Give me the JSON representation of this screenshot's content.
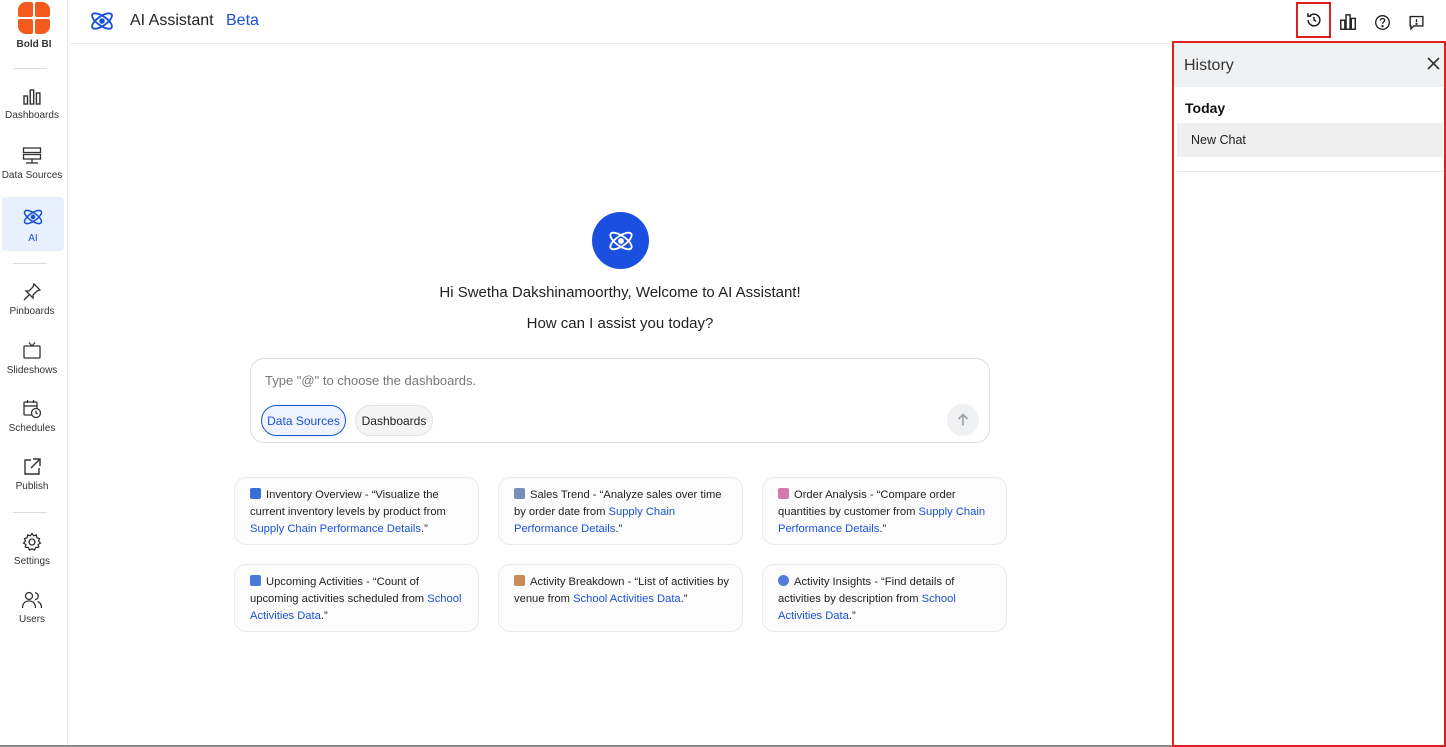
{
  "brand": {
    "name": "Bold BI"
  },
  "nav": {
    "items": [
      {
        "label": "Dashboards",
        "icon": "bar-chart-icon"
      },
      {
        "label": "Data Sources",
        "icon": "server-icon"
      },
      {
        "label": "AI",
        "icon": "atom-icon",
        "active": true
      },
      {
        "label": "Pinboards",
        "icon": "pin-icon"
      },
      {
        "label": "Slideshows",
        "icon": "tv-icon"
      },
      {
        "label": "Schedules",
        "icon": "calendar-clock-icon"
      },
      {
        "label": "Publish",
        "icon": "publish-icon"
      },
      {
        "label": "Settings",
        "icon": "gear-icon"
      },
      {
        "label": "Users",
        "icon": "users-icon"
      }
    ]
  },
  "header": {
    "title": "AI Assistant",
    "badge": "Beta",
    "actions": [
      "history-icon",
      "chart-icon",
      "help-icon",
      "feedback-icon"
    ]
  },
  "main": {
    "greeting": "Hi Swetha Dakshinamoorthy, Welcome to AI Assistant!",
    "question": "How can I assist you today?",
    "prompt": {
      "placeholder": "Type \"@\" to choose the dashboards.",
      "chips": [
        "Data Sources",
        "Dashboards"
      ]
    },
    "suggestions": [
      {
        "icon_color": "#3b6fd8",
        "text": "Inventory Overview - “Visualize the current inventory levels by product from ",
        "link": "Supply Chain Performance Details",
        "tail": ".”"
      },
      {
        "icon_color": "#7a8fb8",
        "text": "Sales Trend - “Analyze sales over time by order date from ",
        "link": "Supply Chain Performance Details",
        "tail": ".”"
      },
      {
        "icon_color": "#d27ab0",
        "text": "Order Analysis - “Compare order quantities by customer from ",
        "link": "Supply Chain Performance Details",
        "tail": ".”"
      },
      {
        "icon_color": "#4a79d9",
        "text": "Upcoming Activities - “Count of upcoming activities scheduled from ",
        "link": "School Activities Data",
        "tail": ".”"
      },
      {
        "icon_color": "#c98b5a",
        "text": "Activity Breakdown - “List of activities by venue from ",
        "link": "School Activities Data",
        "tail": ".”"
      },
      {
        "icon_color": "#4e7ed8",
        "text": "Activity Insights - “Find details of activities by description from ",
        "link": "School Activities Data",
        "tail": ".”"
      }
    ]
  },
  "history": {
    "title": "History",
    "section": "Today",
    "items": [
      "New Chat"
    ]
  }
}
